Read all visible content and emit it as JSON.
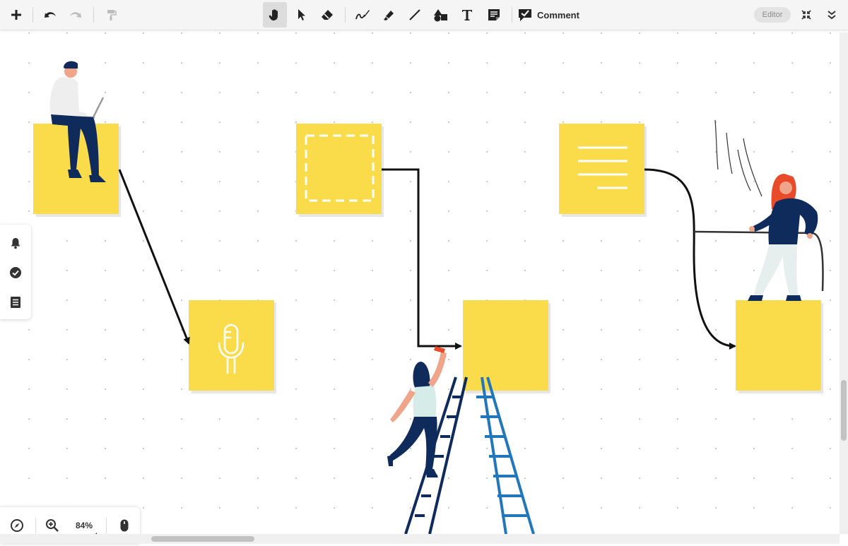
{
  "toolbar": {
    "add": "add-icon",
    "undo": "undo-icon",
    "redo": "redo-icon",
    "format_painter": "paint-roller-icon",
    "tools": [
      {
        "name": "hand-tool",
        "icon": "hand-icon",
        "active": true
      },
      {
        "name": "select-tool",
        "icon": "cursor-arrow-icon",
        "active": false
      },
      {
        "name": "eraser-tool",
        "icon": "eraser-icon",
        "active": false
      },
      {
        "name": "pen-tool",
        "icon": "pen-icon",
        "active": false
      },
      {
        "name": "highlighter-tool",
        "icon": "highlighter-icon",
        "active": false
      },
      {
        "name": "line-tool",
        "icon": "line-icon",
        "active": false
      },
      {
        "name": "shapes-tool",
        "icon": "shapes-icon",
        "active": false
      },
      {
        "name": "text-tool",
        "icon": "text-icon",
        "active": false
      },
      {
        "name": "sticky-note-tool",
        "icon": "sticky-note-icon",
        "active": false
      }
    ],
    "comment_label": "Comment",
    "comment_icon": "comment-check-icon",
    "editor_label": "Editor",
    "fullscreen_icon": "collapse-arrows-icon",
    "more_icon": "double-chevron-down-icon"
  },
  "side_panel": {
    "items": [
      {
        "name": "notifications",
        "icon": "bell-icon"
      },
      {
        "name": "tasks",
        "icon": "check-circle-icon"
      },
      {
        "name": "outline",
        "icon": "list-icon"
      }
    ]
  },
  "zoom_bar": {
    "navigator_icon": "compass-icon",
    "zoom_icon": "zoom-in-icon",
    "zoom_value": "84%",
    "input_icon": "mouse-icon"
  },
  "canvas": {
    "sticky_color": "#fadc4a",
    "sticky_shadow": "#e8e8e8",
    "connector_color": "#111111",
    "stickies": [
      {
        "name": "sticky-top-left",
        "content": "person-on-laptop"
      },
      {
        "name": "sticky-dashed-frame",
        "content": "dashed-rectangle-icon"
      },
      {
        "name": "sticky-text-lines",
        "content": "text-lines-icon"
      },
      {
        "name": "sticky-microphone",
        "content": "microphone-icon"
      },
      {
        "name": "sticky-ladder-target",
        "content": "empty"
      },
      {
        "name": "sticky-right",
        "content": "empty"
      }
    ],
    "illustration_colors": {
      "navy": "#0f2b5b",
      "ladder_blue": "#2277bb",
      "skin": "#f0a48a",
      "hair_red": "#e84a2a",
      "shirt_light": "#eeeeee",
      "pants_light": "#e7efee"
    }
  },
  "scroll": {
    "horizontal_thumb": "h-thumb",
    "vertical_thumb": "v-thumb"
  }
}
